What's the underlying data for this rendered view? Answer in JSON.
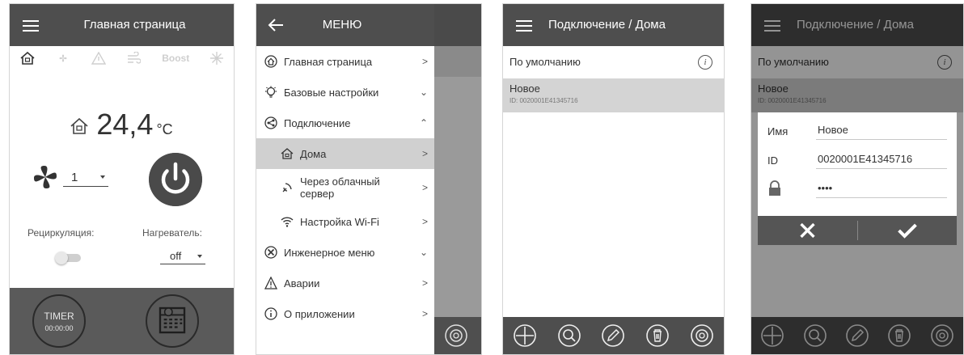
{
  "screen_home": {
    "title": "Главная страница",
    "mode_boost": "Boost",
    "temperature": "24,4",
    "unit": "°C",
    "fan_speed": "1",
    "recirculation_label": "Рециркуляция:",
    "heater_label": "Нагреватель:",
    "heater_value": "off",
    "timer_label": "TIMER",
    "timer_value": "00:00:00"
  },
  "screen_menu": {
    "title": "МЕНЮ",
    "items": [
      {
        "label": "Главная страница"
      },
      {
        "label": "Базовые настройки"
      },
      {
        "label": "Подключение"
      },
      {
        "label": "Дома"
      },
      {
        "label": "Через облачный сервер"
      },
      {
        "label": "Настройка Wi-Fi"
      },
      {
        "label": "Инженерное меню"
      },
      {
        "label": "Аварии"
      },
      {
        "label": "О приложении"
      }
    ]
  },
  "screen_connection": {
    "title": "Подключение / Дома",
    "default_item": "По умолчанию",
    "device_name": "Новое",
    "device_id": "ID: 0020001E41345716"
  },
  "screen_edit": {
    "title": "Подключение / Дома",
    "default_item": "По умолчанию",
    "device_name": "Новое",
    "device_id": "ID: 0020001E41345716",
    "name_label": "Имя",
    "name_value": "Новое",
    "id_label": "ID",
    "id_value": "0020001E41345716",
    "password_value": "••••"
  }
}
